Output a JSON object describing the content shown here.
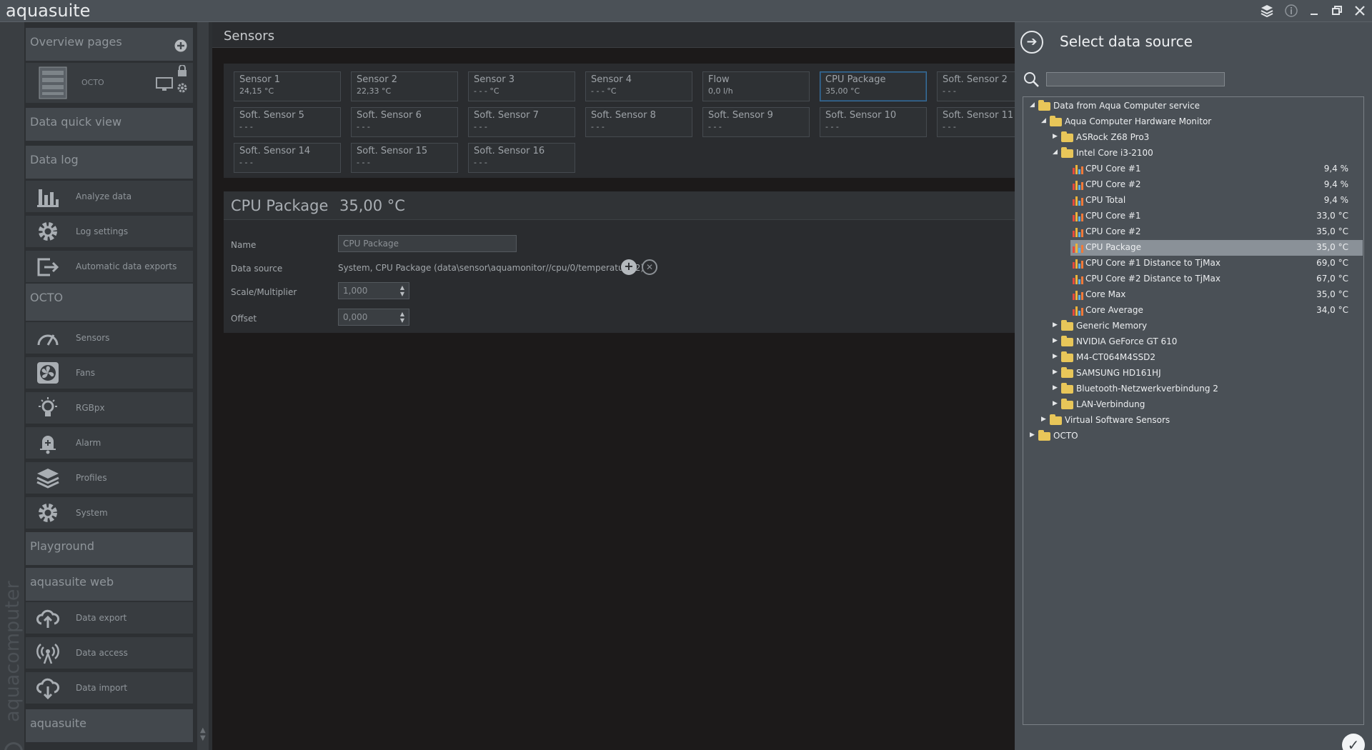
{
  "app": {
    "title": "aquasuite"
  },
  "window_controls": [
    "layers-icon",
    "info-icon",
    "minimize-icon",
    "restore-icon",
    "close-icon"
  ],
  "sidebar": {
    "brand_vertical": "aquacomputer",
    "sections": {
      "overview": "Overview pages",
      "quick_view": "Data quick view",
      "data_log": "Data log",
      "octo": "OCTO",
      "playground": "Playground",
      "aquasuite_web": "aquasuite web",
      "aquasuite": "aquasuite"
    },
    "octo_device_label": "OCTO",
    "data_log_items": [
      {
        "label": "Analyze data",
        "icon": "bar-chart-icon"
      },
      {
        "label": "Log settings",
        "icon": "gear-icon"
      },
      {
        "label": "Automatic data exports",
        "icon": "export-icon"
      }
    ],
    "octo_items": [
      {
        "label": "Sensors",
        "icon": "gauge-icon"
      },
      {
        "label": "Fans",
        "icon": "fan-icon"
      },
      {
        "label": "RGBpx",
        "icon": "lightbulb-icon"
      },
      {
        "label": "Alarm",
        "icon": "bell-icon"
      },
      {
        "label": "Profiles",
        "icon": "layers-icon"
      },
      {
        "label": "System",
        "icon": "gear-icon"
      }
    ],
    "web_items": [
      {
        "label": "Data export",
        "icon": "cloud-upload-icon"
      },
      {
        "label": "Data access",
        "icon": "antenna-icon"
      },
      {
        "label": "Data import",
        "icon": "cloud-download-icon"
      }
    ]
  },
  "main": {
    "title": "Sensors",
    "tiles": [
      {
        "name": "Sensor 1",
        "value": "24,15 °C"
      },
      {
        "name": "Sensor 2",
        "value": "22,33 °C"
      },
      {
        "name": "Sensor 3",
        "value": "- - - °C"
      },
      {
        "name": "Sensor 4",
        "value": "- - - °C"
      },
      {
        "name": "Flow",
        "value": "0,0 l/h"
      },
      {
        "name": "CPU Package",
        "value": "35,00 °C",
        "selected": true
      },
      {
        "name": "Soft. Sensor 2",
        "value": "- - -"
      },
      {
        "name": "Soft. Sensor 5",
        "value": "- - -"
      },
      {
        "name": "Soft. Sensor 6",
        "value": "- - -"
      },
      {
        "name": "Soft. Sensor 7",
        "value": "- - -"
      },
      {
        "name": "Soft. Sensor 8",
        "value": "- - -"
      },
      {
        "name": "Soft. Sensor 9",
        "value": "- - -"
      },
      {
        "name": "Soft. Sensor 10",
        "value": "- - -"
      },
      {
        "name": "Soft. Sensor 11",
        "value": "- - -"
      },
      {
        "name": "Soft. Sensor 14",
        "value": "- - -"
      },
      {
        "name": "Soft. Sensor 15",
        "value": "- - -"
      },
      {
        "name": "Soft. Sensor 16",
        "value": "- - -"
      }
    ],
    "detail": {
      "sensor_name": "CPU Package",
      "sensor_value": "35,00 °C",
      "name_label": "Name",
      "name_value": "CPU Package",
      "data_source_label": "Data source",
      "data_source_value": "System, CPU Package (data\\sensor\\aquamonitor//cpu/0/temperature/2)",
      "scale_label": "Scale/Multiplier",
      "scale_value": "1,000",
      "offset_label": "Offset",
      "offset_value": "0,000"
    }
  },
  "panel": {
    "title": "Select data source",
    "search_placeholder": "",
    "tree": [
      {
        "level": 0,
        "type": "folder",
        "expanded": true,
        "label": "Data from Aqua Computer service"
      },
      {
        "level": 1,
        "type": "folder",
        "expanded": true,
        "label": "Aqua Computer Hardware Monitor"
      },
      {
        "level": 2,
        "type": "folder",
        "expanded": false,
        "label": "ASRock Z68 Pro3"
      },
      {
        "level": 2,
        "type": "folder",
        "expanded": true,
        "label": "Intel Core i3-2100"
      },
      {
        "level": 3,
        "type": "sensor",
        "label": "CPU Core #1",
        "value": "9,4 %"
      },
      {
        "level": 3,
        "type": "sensor",
        "label": "CPU Core #2",
        "value": "9,4 %"
      },
      {
        "level": 3,
        "type": "sensor",
        "label": "CPU Total",
        "value": "9,4 %"
      },
      {
        "level": 3,
        "type": "sensor",
        "label": "CPU Core #1",
        "value": "33,0 °C"
      },
      {
        "level": 3,
        "type": "sensor",
        "label": "CPU Core #2",
        "value": "35,0 °C"
      },
      {
        "level": 3,
        "type": "sensor",
        "label": "CPU Package",
        "value": "35,0 °C",
        "selected": true
      },
      {
        "level": 3,
        "type": "sensor",
        "label": "CPU Core #1 Distance to TjMax",
        "value": "69,0 °C"
      },
      {
        "level": 3,
        "type": "sensor",
        "label": "CPU Core #2 Distance to TjMax",
        "value": "67,0 °C"
      },
      {
        "level": 3,
        "type": "sensor",
        "label": "Core Max",
        "value": "35,0 °C"
      },
      {
        "level": 3,
        "type": "sensor",
        "label": "Core Average",
        "value": "34,0 °C"
      },
      {
        "level": 2,
        "type": "folder",
        "expanded": false,
        "label": "Generic Memory"
      },
      {
        "level": 2,
        "type": "folder",
        "expanded": false,
        "label": "NVIDIA GeForce GT 610"
      },
      {
        "level": 2,
        "type": "folder",
        "expanded": false,
        "label": "M4-CT064M4SSD2"
      },
      {
        "level": 2,
        "type": "folder",
        "expanded": false,
        "label": "SAMSUNG HD161HJ"
      },
      {
        "level": 2,
        "type": "folder",
        "expanded": false,
        "label": "Bluetooth-Netzwerkverbindung 2"
      },
      {
        "level": 2,
        "type": "folder",
        "expanded": false,
        "label": "LAN-Verbindung"
      },
      {
        "level": 1,
        "type": "folder",
        "expanded": false,
        "label": "Virtual Software Sensors"
      },
      {
        "level": 0,
        "type": "folder",
        "expanded": false,
        "label": "OCTO"
      }
    ]
  }
}
